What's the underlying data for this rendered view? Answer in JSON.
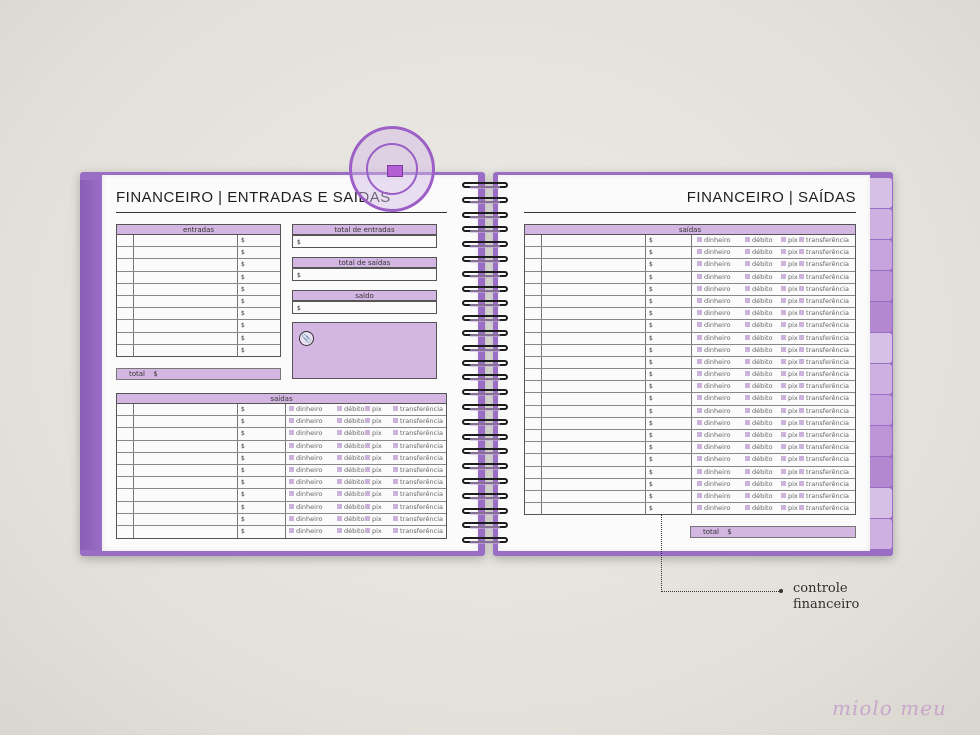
{
  "left_page": {
    "title": "FINANCEIRO | ENTRADAS E SAÍDAS",
    "entradas_header": "entradas",
    "entradas_rows": [
      "$",
      "$",
      "$",
      "$",
      "$",
      "$",
      "$",
      "$",
      "$",
      "$"
    ],
    "total_label": "total",
    "total_currency": "$",
    "total_entradas_header": "total de entradas",
    "total_entradas_currency": "$",
    "total_saidas_header": "total de saídas",
    "total_saidas_currency": "$",
    "saldo_header": "saldo",
    "saldo_currency": "$",
    "saidas_header": "saídas"
  },
  "right_page": {
    "title": "FINANCEIRO | SAÍDAS",
    "saidas_header": "saídas",
    "total_label": "total",
    "total_currency": "$"
  },
  "payment_options": [
    "dinheiro",
    "débito",
    "pix",
    "transferência"
  ],
  "currency": "$",
  "callout": {
    "line1": "controle",
    "line2": "financeiro"
  },
  "brand": "miolo meu",
  "colors": {
    "cover": "#9a6ec4",
    "header_fill": "#d4b6e2",
    "checkbox": "#cdb2dc",
    "tabs": [
      "#d7c0e6",
      "#cfb1e1",
      "#c6a3dc",
      "#bd95d6",
      "#b487d1",
      "#d7c0e6",
      "#cfb1e1",
      "#c6a3dc",
      "#bd95d6",
      "#b487d1",
      "#d7c0e6",
      "#cfb1e1"
    ]
  }
}
